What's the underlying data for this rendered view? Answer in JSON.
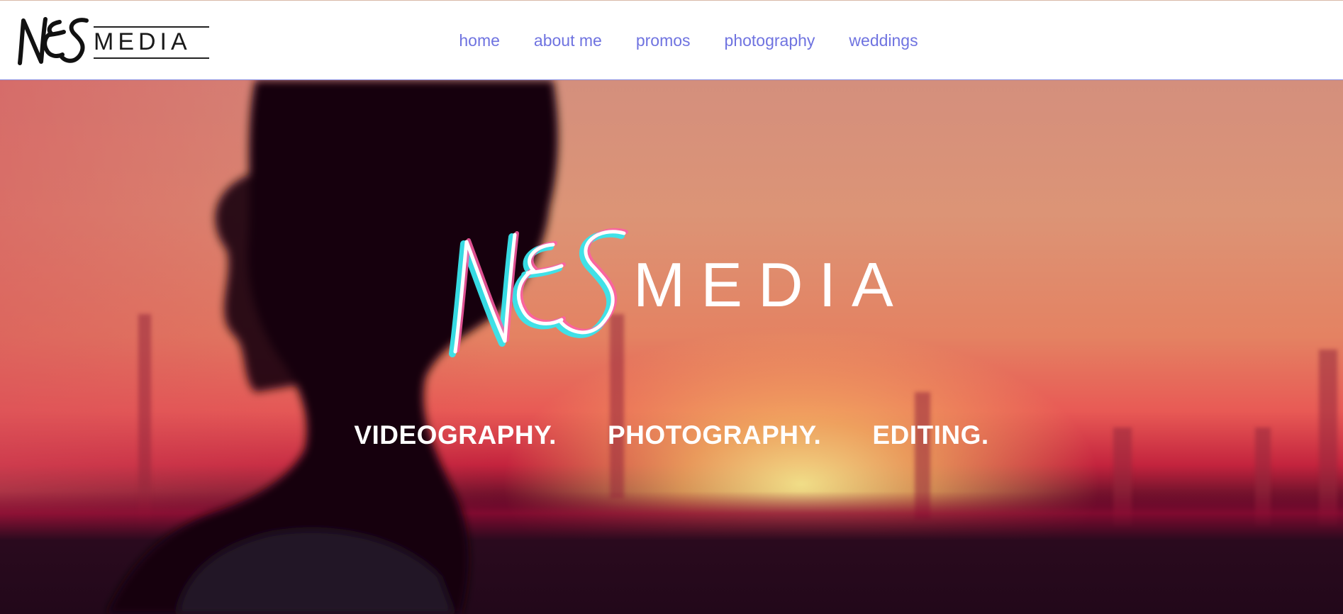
{
  "brand": {
    "logo_word": "MEDIA",
    "logo_script": "NES"
  },
  "nav": {
    "items": [
      {
        "label": "home"
      },
      {
        "label": "about me"
      },
      {
        "label": "promos"
      },
      {
        "label": "photography"
      },
      {
        "label": "weddings"
      }
    ]
  },
  "hero": {
    "logo_word": "MEDIA",
    "logo_script": "NES",
    "taglines": [
      "VIDEOGRAPHY.",
      "PHOTOGRAPHY.",
      "EDITING."
    ]
  },
  "colors": {
    "nav_link": "#6f73e0",
    "header_border": "#8a8fe0",
    "hero_text": "#ffffff"
  }
}
